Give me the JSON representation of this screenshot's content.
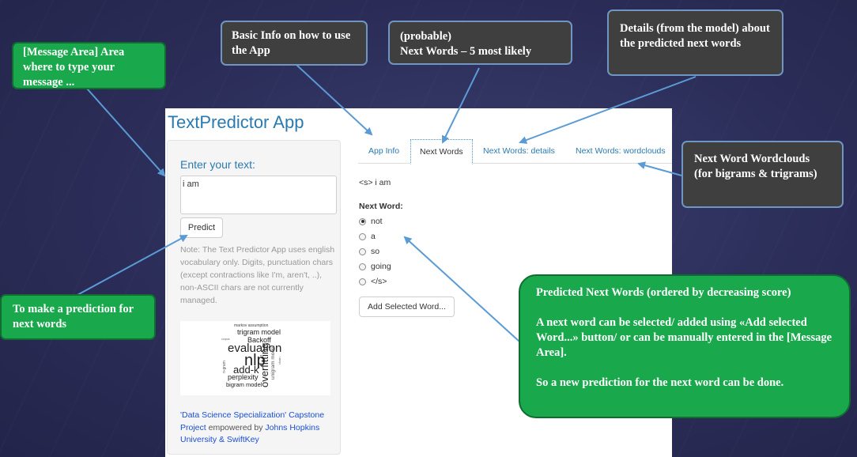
{
  "app": {
    "title": "TextPredictor App",
    "sidebar": {
      "enter_label": "Enter your text:",
      "input_value": "i am",
      "predict_label": "Predict",
      "note": "Note: The Text Predictor App uses english vocabulary only. Digits, punctuation chars (except contractions like I'm, aren't, ..), non-ASCII chars are not currently managed.",
      "credit_link1": "'Data Science Specialization' Capstone Project",
      "credit_text": " empowered by ",
      "credit_link2": "Johns Hopkins University & SwiftKey"
    },
    "tabs": [
      {
        "label": "App Info"
      },
      {
        "label": "Next Words"
      },
      {
        "label": "Next Words: details"
      },
      {
        "label": "Next Words: wordclouds"
      }
    ],
    "sentence": "<s> i am",
    "next_word_label": "Next Word:",
    "options": [
      "not",
      "a",
      "so",
      "going",
      "</s>"
    ],
    "selected_option": "not",
    "add_button_label": "Add Selected Word...",
    "wordcloud_words": {
      "markov": "markov assumption",
      "trigram": "trigram model",
      "backoff": "Backoff",
      "evaluation": "evaluation",
      "nlp": "nlp",
      "addk": "add-k",
      "overfitting": "overfitting",
      "perplexity": "perplexity",
      "bigram": "bigram model",
      "ngram": "n-gram",
      "unigram": "unigram model",
      "tiny1": "smoothing",
      "tiny2": "corpus",
      "tiny3": "chain"
    }
  },
  "callouts": {
    "message_area": "[Message Area] Area where to type your message ...",
    "basic_info": "Basic Info on how to use the App",
    "next_words": "(probable)\nNext Words – 5 most likely",
    "details": "Details (from the model) about the predicted next words",
    "wordclouds": "Next Word Wordclouds  (for bigrams & trigrams)",
    "prediction": "To make a prediction for next words",
    "predicted": "Predicted Next Words (ordered by decreasing score)",
    "predicted_2": "A next word can be selected/ added using «Add selected Word...» button/ or can be manually entered in the [Message  Area].",
    "predicted_3": "So a new prediction for the next word can be done."
  },
  "colors": {
    "background": "#2b2d58",
    "callout_green": "#19a84c",
    "callout_dark": "#3f3f3f",
    "arrow": "#5b9bd5",
    "link_blue": "#2a7ab0"
  }
}
